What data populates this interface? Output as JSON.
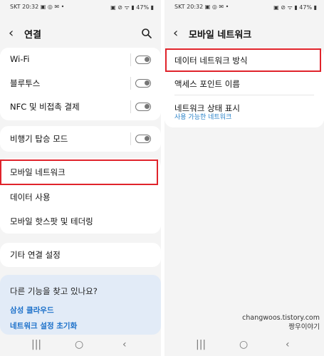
{
  "left": {
    "status_left": "SKT 20:32 ▣ ◎ ✉ •",
    "status_right": "▣ ⊘ ᯤ ▮ 47% ▮",
    "title": "연결",
    "rows": [
      {
        "label": "Wi-Fi"
      },
      {
        "label": "블루투스"
      },
      {
        "label": "NFC 및 비접촉 결제"
      },
      {
        "label": "비행기 탑승 모드"
      },
      {
        "label": "모바일 네트워크"
      },
      {
        "label": "데이터 사용"
      },
      {
        "label": "모바일 핫스팟 및 테더링"
      },
      {
        "label": "기타 연결 설정"
      }
    ],
    "suggest_question": "다른 기능을 찾고 있나요?",
    "suggest_links": [
      "삼성 클라우드",
      "네트워크 설정 초기화"
    ]
  },
  "right": {
    "status_left": "SKT 20:32 ▣ ◎ ✉ •",
    "status_right": "▣ ⊘ ᯤ ▮ 47% ▮",
    "title": "모바일 네트워크",
    "rows": [
      {
        "label": "데이터 네트워크 방식"
      },
      {
        "label": "액세스 포인트 이름"
      },
      {
        "label": "네트워크 상태 표시",
        "sub": "사용 가능한 네트워크"
      }
    ]
  },
  "watermark": {
    "line1": "changwoos.tistory.com",
    "line2": "짱우이야기"
  },
  "nav": {
    "recent": "|||",
    "home": "○",
    "back": "‹"
  },
  "colors": {
    "highlight": "#e0232b",
    "link": "#1a6fc9",
    "sub": "#2b83c9",
    "suggest_bg": "#e2ebf7"
  }
}
